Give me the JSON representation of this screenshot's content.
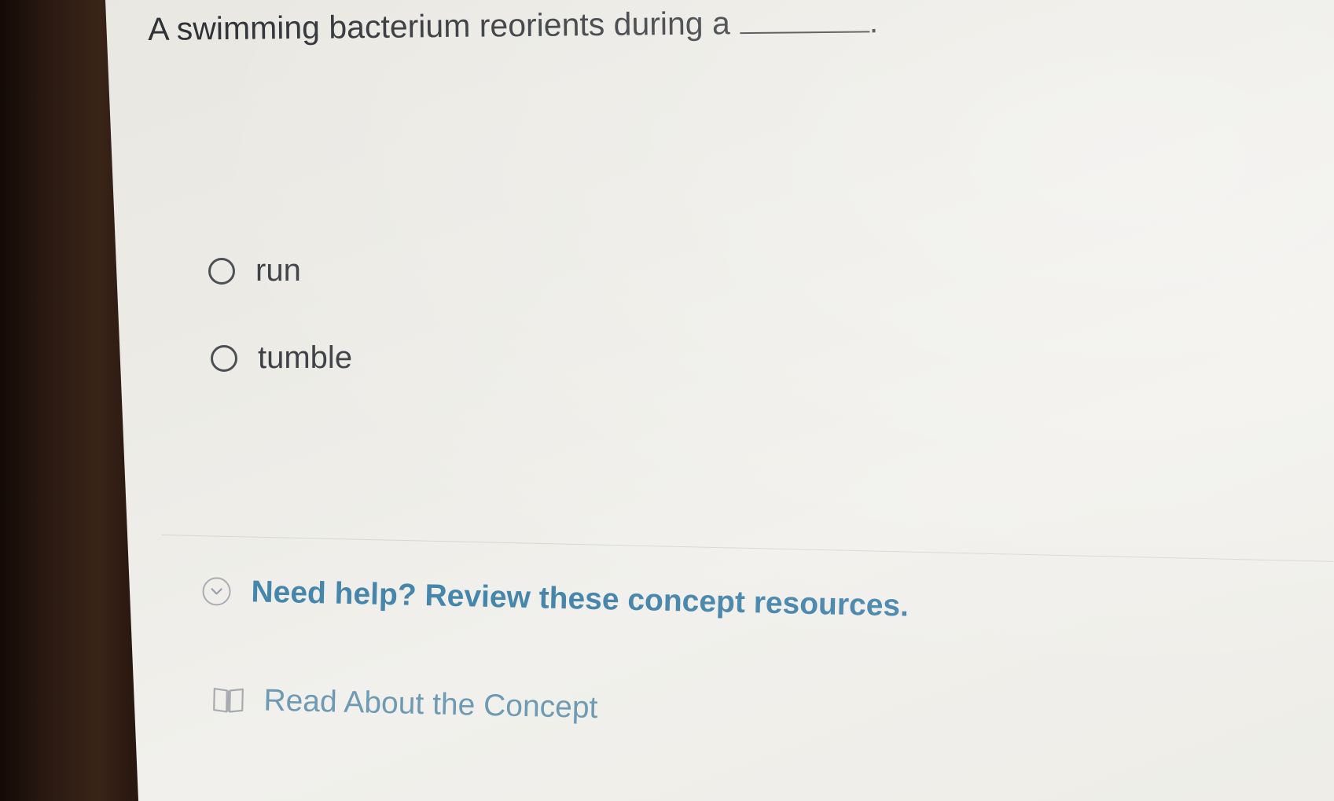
{
  "question": {
    "text": "A swimming bacterium reorients during a",
    "trailing_punctuation": "."
  },
  "options": [
    {
      "label": "run",
      "selected": false
    },
    {
      "label": "tumble",
      "selected": false
    }
  ],
  "help": {
    "toggle_icon": "chevron-down-icon",
    "text": "Need help? Review these concept resources."
  },
  "resources": [
    {
      "icon": "book-icon",
      "label": "Read About the Concept"
    }
  ],
  "colors": {
    "help_link": "#4786ab",
    "resource_link": "#6e9ab3",
    "body_text": "#2f3337"
  }
}
